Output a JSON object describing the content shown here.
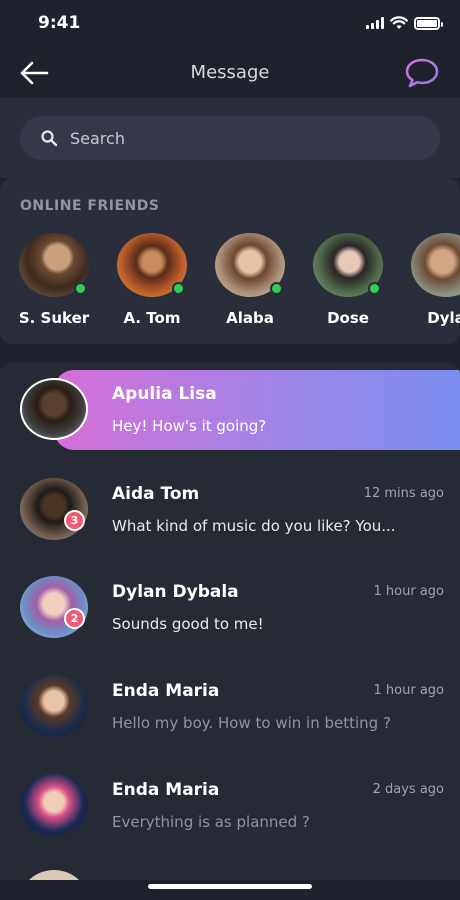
{
  "status_bar": {
    "time": "9:41"
  },
  "header": {
    "title": "Message"
  },
  "search": {
    "placeholder": "Search"
  },
  "online": {
    "title": "ONLINE FRIENDS",
    "friends": [
      {
        "name": "S. Suker",
        "online": true
      },
      {
        "name": "A. Tom",
        "online": true
      },
      {
        "name": "Alaba",
        "online": true
      },
      {
        "name": "Dose",
        "online": true
      },
      {
        "name": "Dyla",
        "online": false
      }
    ]
  },
  "conversations": [
    {
      "name": "Apulia Lisa",
      "message": "Hey! How's it going?",
      "time": "",
      "badge": "",
      "active": true
    },
    {
      "name": "Aida Tom",
      "message": "What kind of music do you like? You...",
      "time": "12 mins ago",
      "badge": "3"
    },
    {
      "name": "Dylan Dybala",
      "message": "Sounds good to me!",
      "time": "1 hour ago",
      "badge": "2"
    },
    {
      "name": "Enda Maria",
      "message": "Hello my boy. How to win in betting ?",
      "time": "1 hour ago",
      "badge": ""
    },
    {
      "name": "Enda Maria",
      "message": "Everything is as planned ?",
      "time": "2 days ago",
      "badge": ""
    }
  ],
  "colors": {
    "background": "#1f222c",
    "panel": "#2a2e3b",
    "accent_gradient_start": "#d56fd7",
    "accent_gradient_end": "#7d8ef0",
    "online_dot": "#2fd155",
    "badge": "#f05a72"
  },
  "icons": {
    "back": "arrow-left-icon",
    "chat": "chat-bubble-icon",
    "search": "search-icon",
    "wifi": "wifi-icon",
    "signal": "signal-icon",
    "battery": "battery-icon"
  }
}
